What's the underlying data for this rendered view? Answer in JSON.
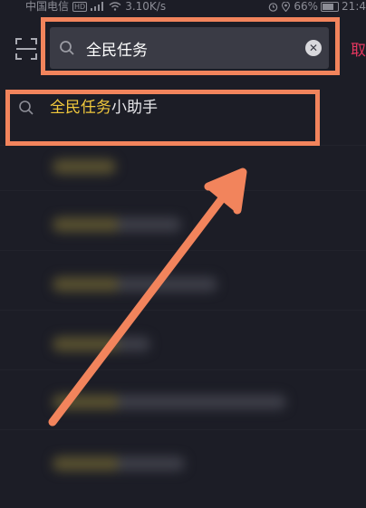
{
  "status_bar": {
    "carrier": "中国电信",
    "hd": "HD",
    "network_speed": "3.10K/s",
    "battery": "66%",
    "time": "21:4"
  },
  "top_bar": {
    "search_query": "全民任务",
    "cancel_label": "取"
  },
  "suggestion": {
    "match_text": "全民任务",
    "rest_text": "小助手"
  },
  "colors": {
    "highlight": "#f2845c",
    "match": "#f0c83c",
    "cancel": "#e5375f",
    "background": "#1c1d26"
  },
  "icons": [
    "scan-icon",
    "search-icon",
    "clear-icon",
    "wifi-icon",
    "alarm-icon",
    "location-icon"
  ]
}
